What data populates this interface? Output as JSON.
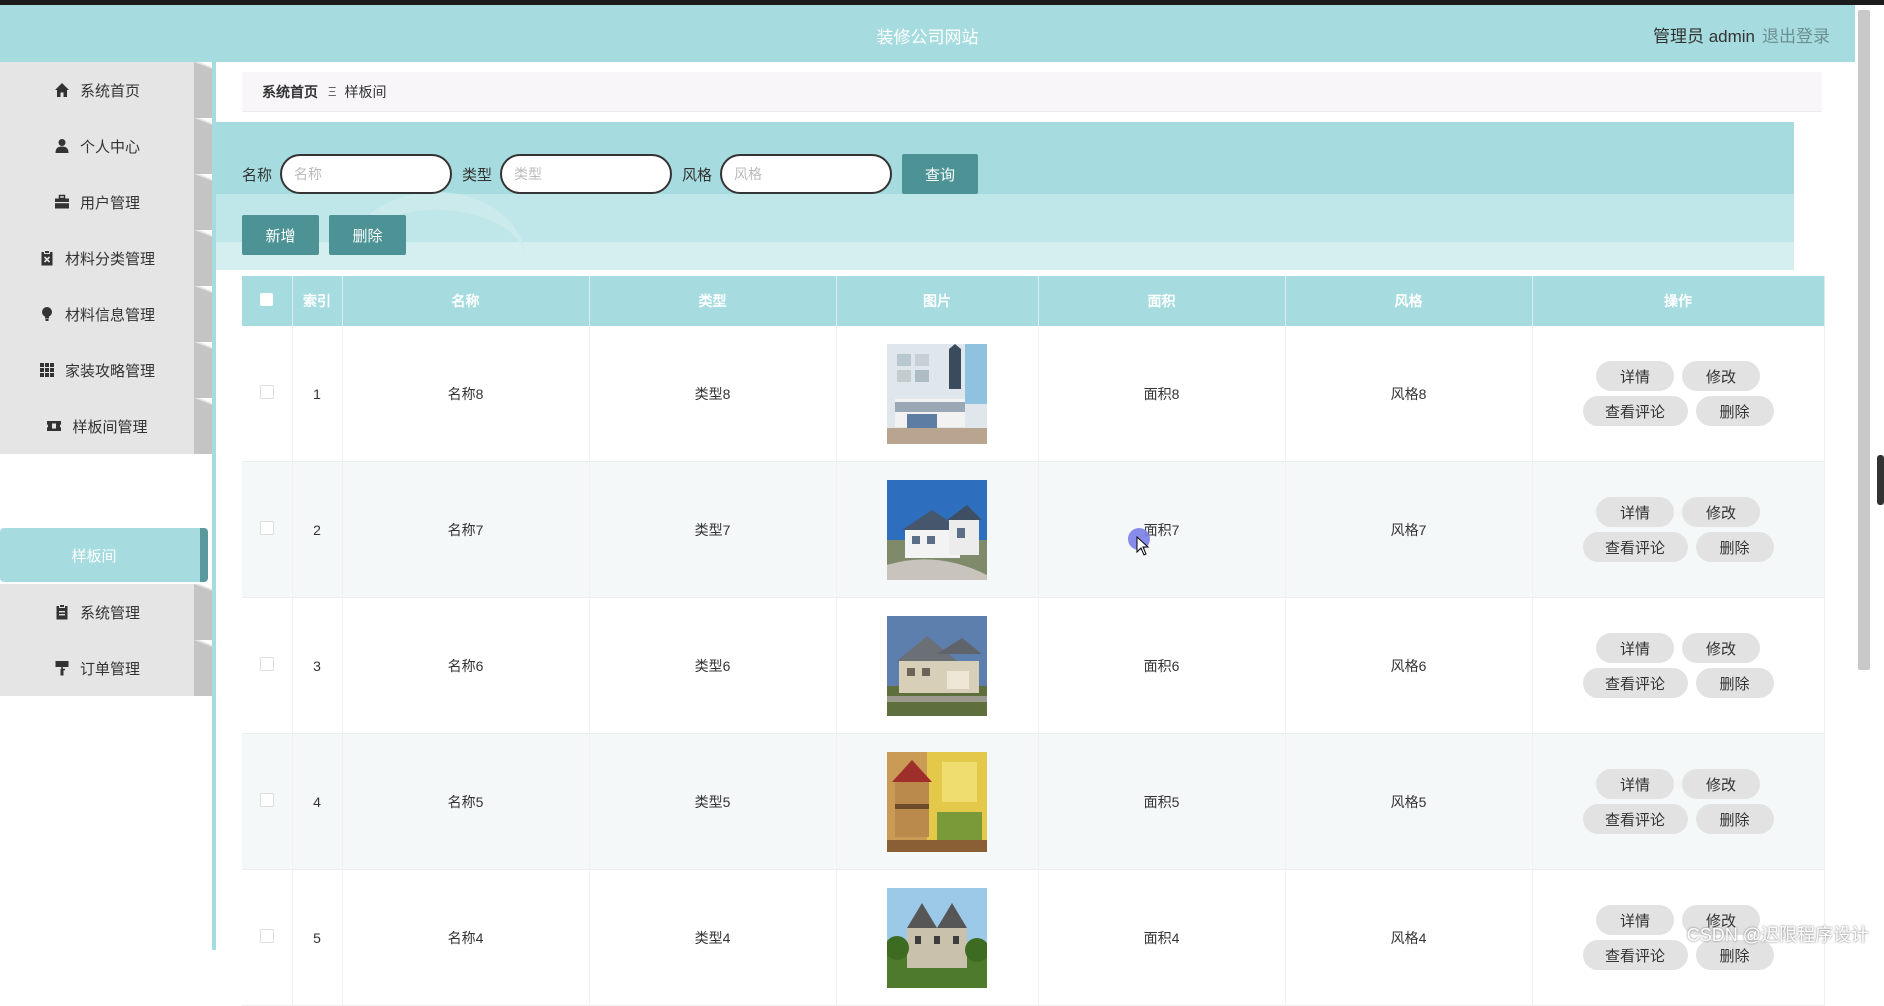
{
  "header": {
    "title": "装修公司网站",
    "user": "管理员 admin",
    "logout": "退出登录"
  },
  "sidebar": {
    "items": [
      {
        "label": "系统首页",
        "icon": "home-icon"
      },
      {
        "label": "个人中心",
        "icon": "person-icon"
      },
      {
        "label": "用户管理",
        "icon": "briefcase-icon"
      },
      {
        "label": "材料分类管理",
        "icon": "clipboard-x-icon"
      },
      {
        "label": "材料信息管理",
        "icon": "lightbulb-icon"
      },
      {
        "label": "家装攻略管理",
        "icon": "grid-icon"
      },
      {
        "label": "样板间管理",
        "icon": "ticket-icon"
      },
      {
        "label": "系统管理",
        "icon": "clipboard-icon"
      },
      {
        "label": "订单管理",
        "icon": "paint-roller-icon"
      }
    ],
    "active_sub": "样板间"
  },
  "breadcrumb": {
    "home": "系统首页",
    "separator": "Ξ",
    "current": "样板间"
  },
  "search": {
    "name_label": "名称",
    "name_placeholder": "名称",
    "type_label": "类型",
    "type_placeholder": "类型",
    "style_label": "风格",
    "style_placeholder": "风格",
    "query": "查询"
  },
  "actions": {
    "add": "新增",
    "delete": "删除"
  },
  "table": {
    "headers": [
      "索引",
      "名称",
      "类型",
      "图片",
      "面积",
      "风格",
      "操作"
    ],
    "rows": [
      {
        "index": "1",
        "name": "名称8",
        "type": "类型8",
        "image": "bedroom-photo",
        "area": "面积8",
        "style": "风格8"
      },
      {
        "index": "2",
        "name": "名称7",
        "type": "类型7",
        "image": "white-villa-photo",
        "area": "面积7",
        "style": "风格7"
      },
      {
        "index": "3",
        "name": "名称6",
        "type": "类型6",
        "image": "suburban-house-photo",
        "area": "面积6",
        "style": "风格6"
      },
      {
        "index": "4",
        "name": "名称5",
        "type": "类型5",
        "image": "kids-bunk-room-photo",
        "area": "面积5",
        "style": "风格5"
      },
      {
        "index": "5",
        "name": "名称4",
        "type": "类型4",
        "image": "stone-manor-photo",
        "area": "面积4",
        "style": "风格4"
      }
    ],
    "row_buttons": {
      "detail": "详情",
      "edit": "修改",
      "comments": "查看评论",
      "delete": "删除"
    }
  },
  "watermark": "CSDN @迟限程序设计",
  "colors": {
    "header_bg": "#a6dcdf",
    "teal_button": "#4d9396",
    "sidebar_item": "#e6e5e5"
  }
}
